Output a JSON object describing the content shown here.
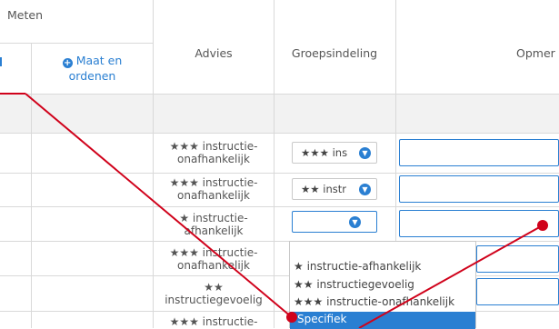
{
  "header": {
    "group_meten": "Meten",
    "maat_en_ordenen_line1": "Maat en",
    "maat_en_ordenen_line2": "ordenen",
    "advies": "Advies",
    "groepsindeling": "Groepsindeling",
    "opmerkingen_partial": "Opmer"
  },
  "rows": [
    {
      "advies_line1": "★★★ instructie-",
      "advies_line2": "onafhankelijk",
      "groep": "★★★ ins"
    },
    {
      "advies_line1": "★★★ instructie-",
      "advies_line2": "onafhankelijk",
      "groep": "★★ instr"
    },
    {
      "advies_line1": "★ instructie-",
      "advies_line2": "afhankelijk",
      "groep": ""
    },
    {
      "advies_line1": "★★★ instructie-",
      "advies_line2": "onafhankelijk"
    },
    {
      "advies_line1": "★★",
      "advies_line2": "instructiegevoelig"
    },
    {
      "advies_line1": "★★★ instructie-",
      "advies_line2": ""
    }
  ],
  "dropdown": {
    "options": [
      "★ instructie-afhankelijk",
      "★★ instructiegevoelig",
      "★★★ instructie-onafhankelijk"
    ],
    "highlighted": "Specifiek"
  },
  "colors": {
    "accent": "#2a7fd2",
    "annotation": "#d0021b",
    "band": "#f2f2f2"
  },
  "icons": {
    "chevron": "chevron-down-icon",
    "plus": "plus-circle-icon"
  }
}
